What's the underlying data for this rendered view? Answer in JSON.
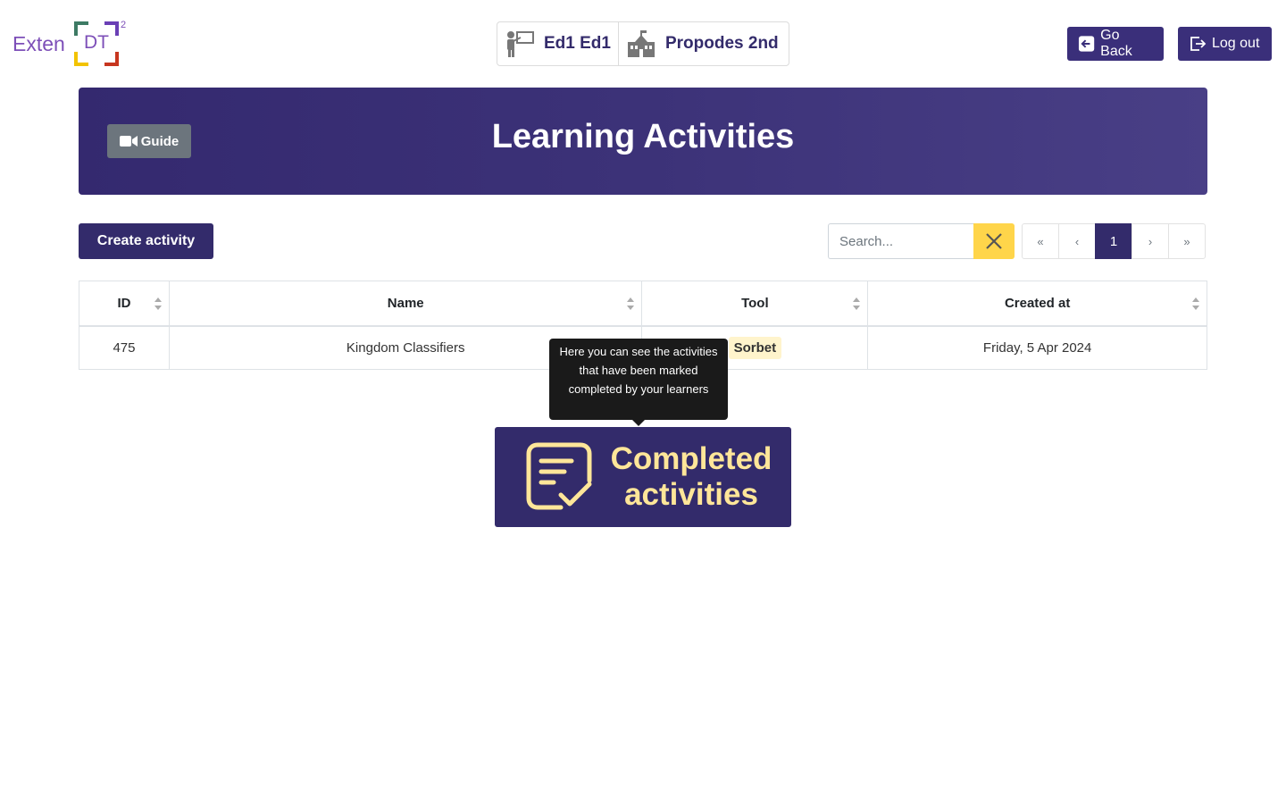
{
  "header": {
    "logo": {
      "text": "Exten",
      "dt": "DT",
      "sup": "2"
    },
    "user_name": "Ed1 Ed1",
    "school_name": "Propodes 2nd",
    "go_back_label": "Go Back",
    "log_out_label": "Log out"
  },
  "banner": {
    "guide_label": "Guide",
    "title": "Learning Activities"
  },
  "toolbar": {
    "create_label": "Create activity",
    "search_placeholder": "Search...",
    "pager": {
      "first": "«",
      "prev": "‹",
      "current": "1",
      "next": "›",
      "last": "»"
    }
  },
  "table": {
    "columns": [
      "ID",
      "Name",
      "Tool",
      "Created at"
    ],
    "rows": [
      {
        "id": "475",
        "name": "Kingdom Classifiers",
        "tool": "Sorbet",
        "created_at": "Friday, 5 Apr 2024"
      }
    ]
  },
  "tooltip": {
    "text": "Here you can see the activities that have been marked completed by your learners"
  },
  "completed_card": {
    "line1": "Completed",
    "line2": "activities"
  },
  "colors": {
    "brand_primary": "#332b6b",
    "accent_yellow": "#ffd54a",
    "completed_text": "#ffe699",
    "logo_purple": "#7d4fb8"
  }
}
